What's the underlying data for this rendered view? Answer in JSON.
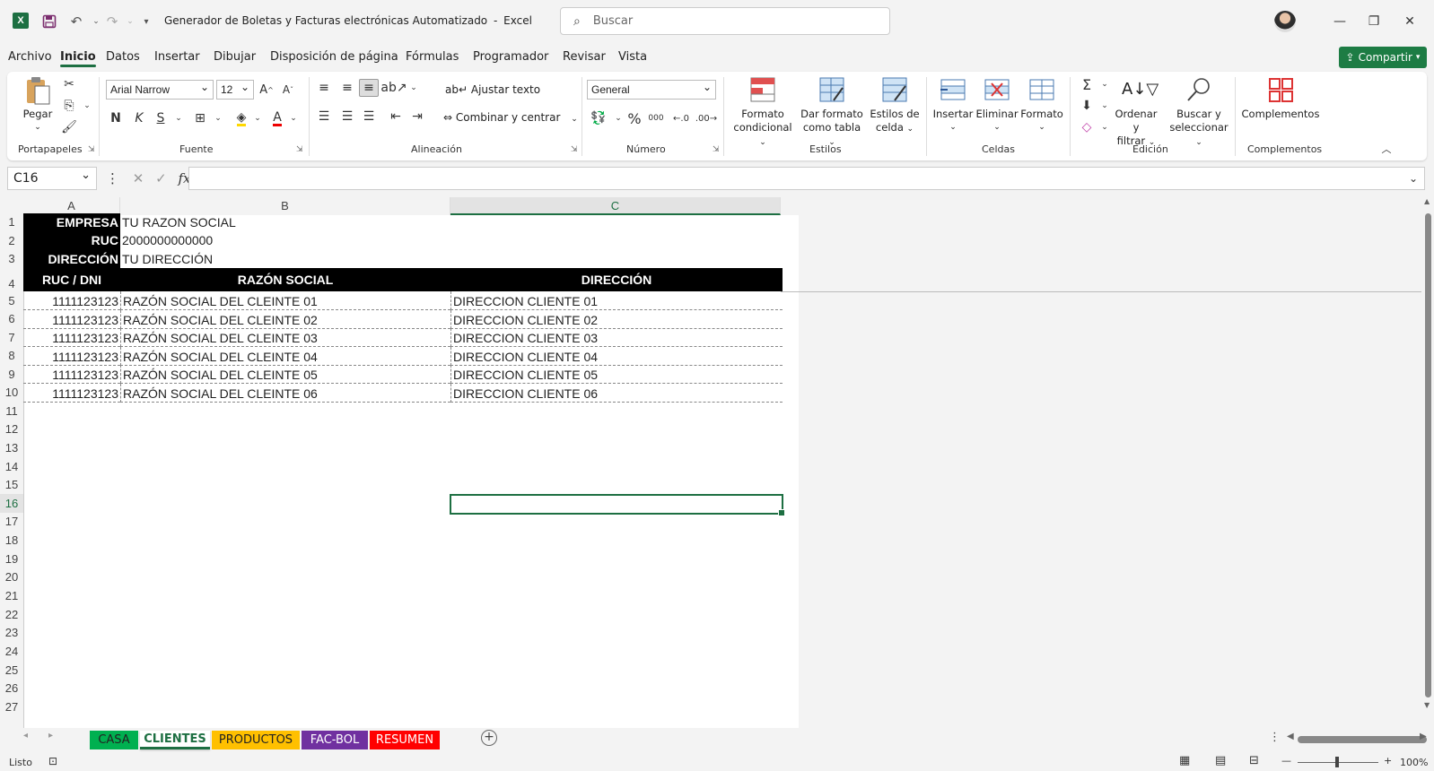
{
  "title": {
    "file": "Generador de Boletas y Facturas electrónicas Automatizado",
    "separator": "-",
    "app": "Excel"
  },
  "search": {
    "placeholder": "Buscar"
  },
  "menu": [
    "Archivo",
    "Inicio",
    "Datos",
    "Insertar",
    "Dibujar",
    "Disposición de página",
    "Fórmulas",
    "Programador",
    "Revisar",
    "Vista"
  ],
  "share_label": "Compartir",
  "ribbon": {
    "clipboard": {
      "paste": "Pegar",
      "label": "Portapapeles"
    },
    "font": {
      "name": "Arial Narrow",
      "size": "12",
      "bold": "N",
      "italic": "K",
      "underline": "S",
      "label": "Fuente"
    },
    "alignment": {
      "wrap": "Ajustar texto",
      "merge": "Combinar y centrar",
      "label": "Alineación"
    },
    "number": {
      "format": "General",
      "percent": "%",
      "thousands": "000",
      "label": "Número"
    },
    "styles": {
      "conditional_1": "Formato",
      "conditional_2": "condicional",
      "table_1": "Dar formato",
      "table_2": "como tabla",
      "cell_1": "Estilos de",
      "cell_2": "celda",
      "label": "Estilos"
    },
    "cells": {
      "insert": "Insertar",
      "delete": "Eliminar",
      "format": "Formato",
      "label": "Celdas"
    },
    "editing": {
      "sort_1": "Ordenar y",
      "sort_2": "filtrar",
      "find_1": "Buscar y",
      "find_2": "seleccionar",
      "label": "Edición"
    },
    "addins": {
      "button": "Complementos",
      "label": "Complementos"
    }
  },
  "namebox": "C16",
  "fx": "fx",
  "columns": [
    "A",
    "B",
    "C"
  ],
  "rows": [
    "1",
    "2",
    "3",
    "4",
    "5",
    "6",
    "7",
    "8",
    "9",
    "10",
    "11",
    "12",
    "13",
    "14",
    "15",
    "16",
    "17",
    "18",
    "19",
    "20",
    "21",
    "22",
    "23",
    "24",
    "25",
    "26",
    "27"
  ],
  "company": {
    "empresa_label": "EMPRESA",
    "empresa_value": "TU RAZON SOCIAL",
    "ruc_label": "RUC",
    "ruc_value": "2000000000000",
    "dir_label": "DIRECCIÓN",
    "dir_value": "TU DIRECCIÓN"
  },
  "table": {
    "headers": [
      "RUC / DNI",
      "RAZÓN SOCIAL",
      "DIRECCIÓN"
    ],
    "rows": [
      [
        "1111123123",
        "RAZÓN SOCIAL DEL CLEINTE 01",
        "DIRECCION CLIENTE 01"
      ],
      [
        "1111123123",
        "RAZÓN SOCIAL DEL CLEINTE 02",
        "DIRECCION CLIENTE 02"
      ],
      [
        "1111123123",
        "RAZÓN SOCIAL DEL CLEINTE 03",
        "DIRECCION CLIENTE 03"
      ],
      [
        "1111123123",
        "RAZÓN SOCIAL DEL CLEINTE 04",
        "DIRECCION CLIENTE 04"
      ],
      [
        "1111123123",
        "RAZÓN SOCIAL DEL CLEINTE 05",
        "DIRECCION CLIENTE 05"
      ],
      [
        "1111123123",
        "RAZÓN SOCIAL DEL CLEINTE 06",
        "DIRECCION CLIENTE 06"
      ]
    ]
  },
  "sheets": [
    {
      "name": "CASA",
      "color": "#00b050",
      "text": "#222222"
    },
    {
      "name": "CLIENTES",
      "color": "#ffffff",
      "text": "#1d6f42"
    },
    {
      "name": "PRODUCTOS",
      "color": "#ffc000",
      "text": "#222222"
    },
    {
      "name": "FAC-BOL",
      "color": "#7030a0",
      "text": "#ffffff"
    },
    {
      "name": "RESUMEN",
      "color": "#ff0000",
      "text": "#ffffff"
    }
  ],
  "status": {
    "ready": "Listo",
    "zoom": "100%"
  },
  "colors": {
    "accent": "#1d6f42"
  }
}
